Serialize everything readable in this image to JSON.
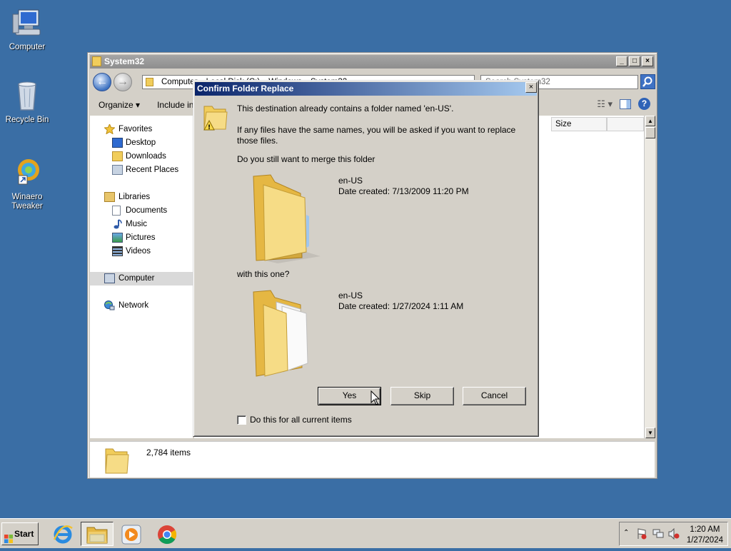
{
  "desktop": {
    "icons": [
      {
        "label": "Computer",
        "icon": "computer-icon"
      },
      {
        "label": "Recycle Bin",
        "icon": "recycle-bin-icon"
      },
      {
        "label": "Winaero Tweaker",
        "icon": "winaero-tweaker-icon"
      }
    ]
  },
  "explorer": {
    "title": "System32",
    "address": "Computer ▸ Local Disk (C:) ▸ Windows ▸ System32",
    "search_placeholder": "Search System32",
    "toolbar": {
      "organize": "Organize",
      "include": "Include in l"
    },
    "columns": {
      "size": "Size"
    },
    "nav": {
      "favorites": "Favorites",
      "desktop": "Desktop",
      "downloads": "Downloads",
      "recent": "Recent Places",
      "libraries": "Libraries",
      "documents": "Documents",
      "music": "Music",
      "pictures": "Pictures",
      "videos": "Videos",
      "computer": "Computer",
      "network": "Network"
    },
    "status": {
      "item_count": "2,784 items"
    }
  },
  "dialog": {
    "title": "Confirm Folder Replace",
    "line1": "This destination already contains a folder named 'en-US'.",
    "line2a": "If any files have the same names, you will be asked if you want to replace",
    "line2b": "those files.",
    "line3": "Do you still want to merge this folder",
    "existing": {
      "name": "en-US",
      "date": "Date created: 7/13/2009 11:20 PM"
    },
    "with_label": "with this one?",
    "incoming": {
      "name": "en-US",
      "date": "Date created: 1/27/2024 1:11 AM"
    },
    "buttons": {
      "yes": "Yes",
      "skip": "Skip",
      "cancel": "Cancel"
    },
    "checkbox_label": "Do this for all current items",
    "checkbox_checked": false
  },
  "taskbar": {
    "start": "Start",
    "apps": [
      "internet-explorer-icon",
      "windows-explorer-icon",
      "media-player-icon",
      "chrome-icon"
    ],
    "clock": {
      "time": "1:20 AM",
      "date": "1/27/2024"
    }
  },
  "colors": {
    "desktop": "#3a6ea5",
    "dialog_title_start": "#0a246a",
    "dialog_title_end": "#a6caf0",
    "folder": "#f1cd5b"
  }
}
